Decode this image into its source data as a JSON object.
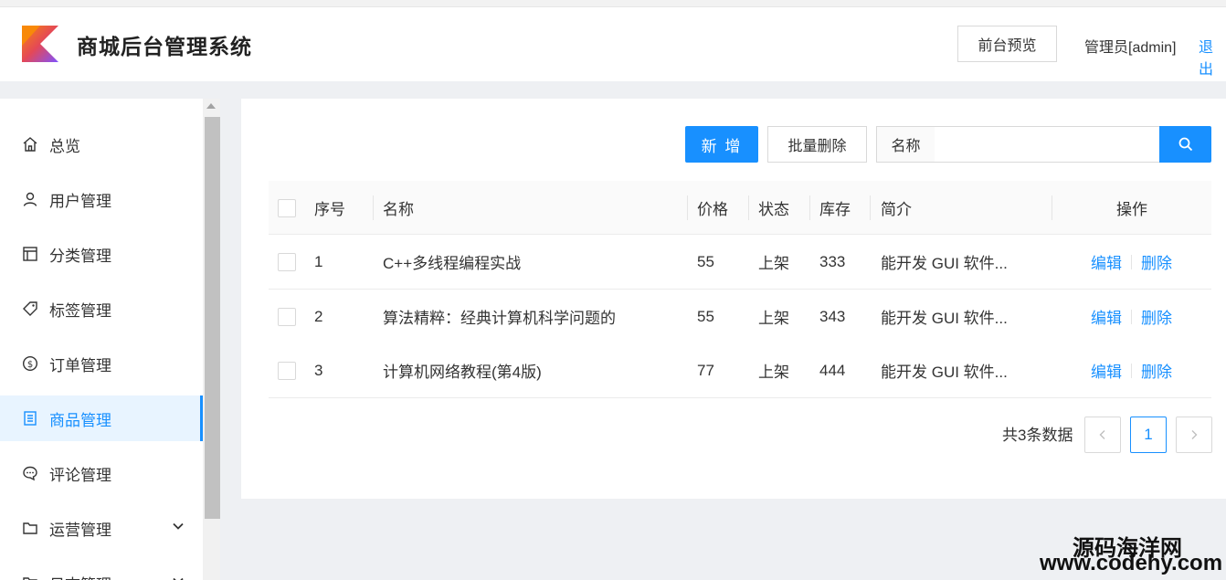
{
  "header": {
    "title": "商城后台管理系统",
    "preview_label": "前台预览",
    "user_label": "管理员[admin]",
    "logout_label": "退出"
  },
  "colors": {
    "accent": "#1890ff",
    "active_bg": "#e8f4ff"
  },
  "sidebar": {
    "items": [
      {
        "label": "总览",
        "icon": "home-icon"
      },
      {
        "label": "用户管理",
        "icon": "user-icon"
      },
      {
        "label": "分类管理",
        "icon": "layout-icon"
      },
      {
        "label": "标签管理",
        "icon": "tag-icon"
      },
      {
        "label": "订单管理",
        "icon": "dollar-icon"
      },
      {
        "label": "商品管理",
        "icon": "list-icon",
        "active": true
      },
      {
        "label": "评论管理",
        "icon": "comment-icon"
      },
      {
        "label": "运营管理",
        "icon": "folder-icon",
        "expandable": true
      },
      {
        "label": "日志管理",
        "icon": "folder-icon",
        "expandable": true
      }
    ]
  },
  "toolbar": {
    "add_label": "新 增",
    "batch_delete_label": "批量删除",
    "search_label": "名称",
    "search_value": "",
    "search_placeholder": ""
  },
  "table": {
    "columns": [
      "序号",
      "名称",
      "价格",
      "状态",
      "库存",
      "简介",
      "操作"
    ],
    "rows": [
      {
        "index": "1",
        "name": "C++多线程编程实战",
        "price": "55",
        "status": "上架",
        "stock": "333",
        "desc": "能开发 GUI 软件..."
      },
      {
        "index": "2",
        "name": "算法精粹：经典计算机科学问题的",
        "price": "55",
        "status": "上架",
        "stock": "343",
        "desc": "能开发 GUI 软件..."
      },
      {
        "index": "3",
        "name": "计算机网络教程(第4版)",
        "price": "77",
        "status": "上架",
        "stock": "444",
        "desc": "能开发 GUI 软件..."
      }
    ],
    "edit_label": "编辑",
    "delete_label": "删除"
  },
  "pagination": {
    "total_text": "共3条数据",
    "current_page": "1"
  },
  "watermark": {
    "line1": "源码海洋网",
    "line2": "www.codehy.com"
  }
}
